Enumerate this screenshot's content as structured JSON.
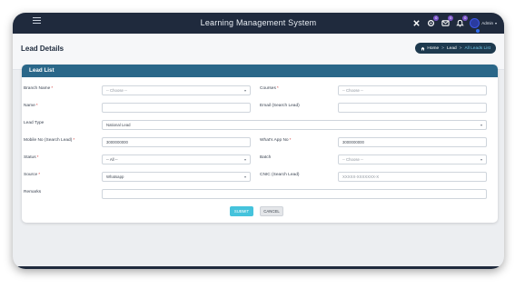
{
  "app": {
    "title": "Learning Management System"
  },
  "topbar": {
    "icons": [
      {
        "name": "close-x-icon",
        "badge": ""
      },
      {
        "name": "settings-icon",
        "badge": "0"
      },
      {
        "name": "messages-icon",
        "badge": "0"
      },
      {
        "name": "bell-icon",
        "badge": "0"
      }
    ],
    "user": {
      "name": "Admin"
    }
  },
  "page": {
    "title": "Lead Details",
    "breadcrumb": {
      "home": "Home",
      "section": "Lead",
      "current": "All Leads List"
    }
  },
  "card": {
    "title": "Lead List"
  },
  "form": {
    "branch_name": {
      "label": "Branch Name",
      "required": "*",
      "value": "-- Choose --"
    },
    "courses": {
      "label": "Courses",
      "required": "*",
      "value": "-- Choose --"
    },
    "name": {
      "label": "Name",
      "required": "*",
      "value": ""
    },
    "email": {
      "label": "Email (Search Lead)",
      "value": ""
    },
    "lead_type": {
      "label": "Lead Type",
      "value": "National Lead"
    },
    "mobile": {
      "label": "Mobile No (Search Lead)",
      "required": "*",
      "value": "3000000000"
    },
    "whatsapp": {
      "label": "What's App No",
      "required": "*",
      "value": "3000000000"
    },
    "status": {
      "label": "Status",
      "required": "*",
      "value": "-- All --"
    },
    "batch": {
      "label": "Batch",
      "value": "-- Choose --"
    },
    "source": {
      "label": "Source",
      "required": "*",
      "value": "Whatsapp"
    },
    "cnic": {
      "label": "CNIC (Search Lead)",
      "placeholder": "XXXXX-XXXXXXX-X"
    },
    "remarks": {
      "label": "Remarks",
      "value": ""
    },
    "submit_label": "SUBMIT",
    "cancel_label": "CANCEL"
  },
  "colors": {
    "topbar": "#1f2a3d",
    "card_header": "#2a6789",
    "submit": "#45c3dc",
    "breadcrumb_bg": "#1e3a4f"
  }
}
